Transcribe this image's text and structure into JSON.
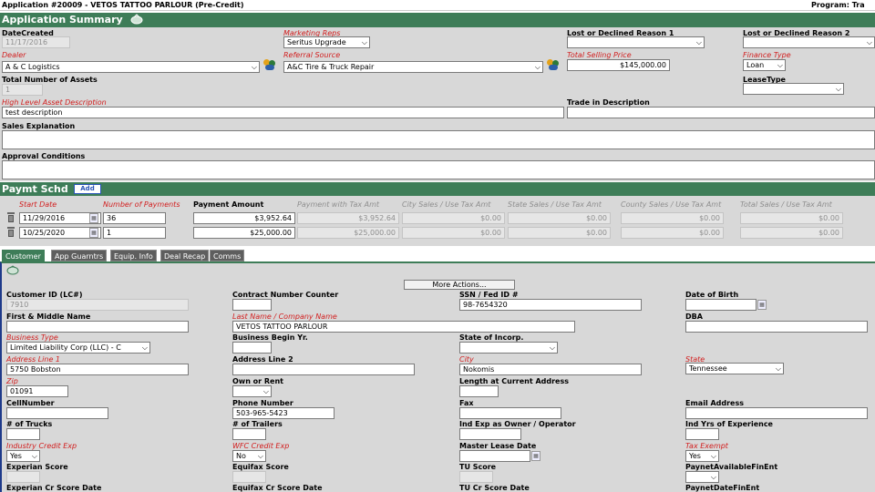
{
  "top_bar": {
    "title": "Application #20009 - VETOS TATTOO PARLOUR (Pre-Credit)",
    "program": "Program: Tra"
  },
  "app_summary": {
    "title": "Application Summary",
    "date_created": {
      "label": "DateCreated",
      "value": "11/17/2016"
    },
    "marketing_reps": {
      "label": "Marketing Reps",
      "value": "Seritus Upgrade"
    },
    "lost_reason_1": {
      "label": "Lost or Declined Reason 1",
      "value": ""
    },
    "lost_reason_2": {
      "label": "Lost or Declined Reason 2",
      "value": ""
    },
    "dealer": {
      "label": "Dealer",
      "value": "A & C Logistics"
    },
    "referral_source": {
      "label": "Referral Source",
      "value": "A&C Tire & Truck Repair"
    },
    "total_selling_price": {
      "label": "Total Selling Price",
      "value": "$145,000.00"
    },
    "finance_type": {
      "label": "Finance Type",
      "value": "Loan"
    },
    "total_assets": {
      "label": "Total Number of Assets",
      "value": "1"
    },
    "lease_type": {
      "label": "LeaseType",
      "value": ""
    },
    "high_level_desc": {
      "label": "High Level Asset Description",
      "value": "test description"
    },
    "trade_in_desc": {
      "label": "Trade in Description",
      "value": ""
    },
    "sales_explanation": {
      "label": "Sales Explanation",
      "value": ""
    },
    "approval_conditions": {
      "label": "Approval Conditions",
      "value": ""
    }
  },
  "payment_schedule": {
    "title": "Paymt Schd",
    "add_label": "Add",
    "headers": [
      "Start Date",
      "Number of Payments",
      "Payment Amount",
      "Payment with Tax Amt",
      "City Sales / Use Tax Amt",
      "State Sales / Use Tax Amt",
      "County Sales / Use Tax Amt",
      "Total Sales / Use Tax Amt"
    ],
    "rows": [
      [
        "11/29/2016",
        "36",
        "$3,952.64",
        "$3,952.64",
        "$0.00",
        "$0.00",
        "$0.00",
        "$0.00"
      ],
      [
        "10/25/2020",
        "1",
        "$25,000.00",
        "$25,000.00",
        "$0.00",
        "$0.00",
        "$0.00",
        "$0.00"
      ]
    ]
  },
  "tabs": [
    "Customer",
    "App Guarntrs",
    "Equip. Info",
    "Deal Recap",
    "Comms"
  ],
  "customer": {
    "more_actions": "More Actions...",
    "customer_id": {
      "label": "Customer ID (LC#)",
      "value": "7910"
    },
    "contract_counter": {
      "label": "Contract Number Counter",
      "value": ""
    },
    "ssn": {
      "label": "SSN / Fed ID #",
      "value": "98-7654320"
    },
    "dob": {
      "label": "Date of Birth",
      "value": ""
    },
    "first_middle": {
      "label": "First & Middle Name",
      "value": ""
    },
    "last_name": {
      "label": "Last Name / Company Name",
      "value": "VETOS TATTOO PARLOUR"
    },
    "dba": {
      "label": "DBA",
      "value": ""
    },
    "business_type": {
      "label": "Business Type",
      "value": "Limited Liability Corp (LLC) - C"
    },
    "business_begin": {
      "label": "Business Begin Yr.",
      "value": ""
    },
    "state_incorp": {
      "label": "State of Incorp.",
      "value": ""
    },
    "address1": {
      "label": "Address Line 1",
      "value": "5750 Bobston"
    },
    "address2": {
      "label": "Address Line 2",
      "value": ""
    },
    "city": {
      "label": "City",
      "value": "Nokomis"
    },
    "state": {
      "label": "State",
      "value": "Tennessee"
    },
    "zip": {
      "label": "Zip",
      "value": "01091"
    },
    "own_rent": {
      "label": "Own or Rent",
      "value": ""
    },
    "length_at_address": {
      "label": "Length at Current Address",
      "value": ""
    },
    "cell": {
      "label": "CellNumber",
      "value": ""
    },
    "phone": {
      "label": "Phone Number",
      "value": "503-965-5423"
    },
    "fax": {
      "label": "Fax",
      "value": ""
    },
    "email": {
      "label": "Email Address",
      "value": ""
    },
    "trucks": {
      "label": "# of Trucks",
      "value": ""
    },
    "trailers": {
      "label": "# of Trailers",
      "value": ""
    },
    "ind_exp_owner": {
      "label": "Ind Exp as Owner / Operator",
      "value": ""
    },
    "ind_yrs_exp": {
      "label": "Ind Yrs of Experience",
      "value": ""
    },
    "industry_credit": {
      "label": "Industry Credit Exp",
      "value": "Yes"
    },
    "wfc_credit": {
      "label": "WFC Credit Exp",
      "value": "No"
    },
    "master_lease": {
      "label": "Master Lease Date",
      "value": ""
    },
    "tax_exempt": {
      "label": "Tax Exempt",
      "value": "Yes"
    },
    "experian": {
      "label": "Experian Score",
      "value": ""
    },
    "equifax": {
      "label": "Equifax Score",
      "value": ""
    },
    "tu": {
      "label": "TU Score",
      "value": ""
    },
    "paynet_avail": {
      "label": "PaynetAvailableFinEnt",
      "value": ""
    },
    "experian_date": {
      "label": "Experian Cr Score Date"
    },
    "equifax_date": {
      "label": "Equifax Cr Score Date"
    },
    "tu_date": {
      "label": "TU Cr Score Date"
    },
    "paynet_date": {
      "label": "PaynetDateFinEnt"
    }
  },
  "colors": {
    "header_green": "#3e7d58",
    "section_bg": "#d8d8d8",
    "label_red": "#d21e1e",
    "tab_grey": "#5e5e5e"
  }
}
